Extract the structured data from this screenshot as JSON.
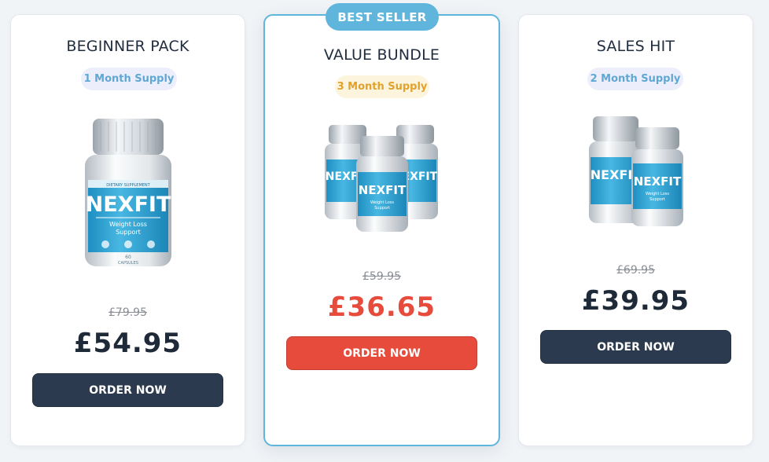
{
  "cards": [
    {
      "title": "BEGINNER PACK",
      "supply": "1 Month Supply",
      "old_price": "£79.95",
      "price": "£54.95",
      "cta": "ORDER NOW",
      "bottle_count": 1
    },
    {
      "badge": "BEST SELLER",
      "title": "VALUE BUNDLE",
      "supply": "3 Month Supply",
      "old_price": "£59.95",
      "price": "£36.65",
      "cta": "ORDER NOW",
      "bottle_count": 3
    },
    {
      "title": "SALES HIT",
      "supply": "2 Month Supply",
      "old_price": "£69.95",
      "price": "£39.95",
      "cta": "ORDER NOW",
      "bottle_count": 2
    }
  ],
  "product": {
    "brand": "NEXFIT",
    "tag": "DIETARY SUPPLEMENT",
    "line1": "Weight Loss",
    "line2": "Support",
    "count": "60",
    "unit": "CAPSULES"
  },
  "colors": {
    "accent": "#5fb5dc",
    "price_red": "#e64b3c",
    "button_dark": "#2b3a4e",
    "text_dark": "#1e2a38"
  }
}
